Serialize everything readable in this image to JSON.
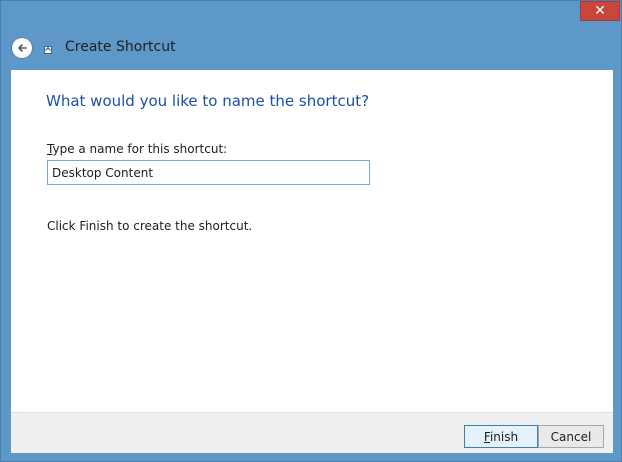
{
  "window": {
    "title": "Create Shortcut",
    "close_label": "✕"
  },
  "main": {
    "question": "What would you like to name the shortcut?",
    "name_label_prefix": "T",
    "name_label_rest": "ype a name for this shortcut:",
    "name_value": "Desktop Content",
    "hint": "Click Finish to create the shortcut."
  },
  "footer": {
    "finish_prefix": "F",
    "finish_rest": "inish",
    "cancel_label": "Cancel"
  },
  "colors": {
    "frame": "#5e98c9",
    "accent_text": "#1c4fa6",
    "close": "#c7463d"
  }
}
